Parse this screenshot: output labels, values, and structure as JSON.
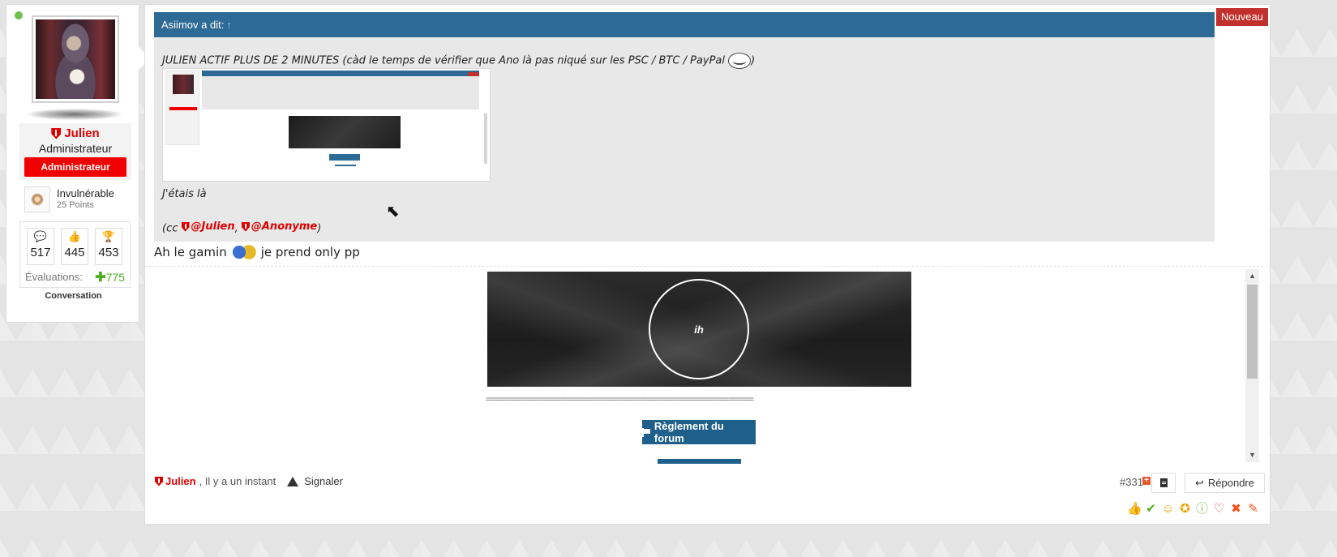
{
  "user": {
    "name": "Julien",
    "title": "Administrateur",
    "badge": "Administrateur",
    "rank_title": "Invulnérable",
    "rank_points": "25 Points",
    "stats": [
      {
        "icon": "comments-icon",
        "glyph": "💬",
        "value": "517"
      },
      {
        "icon": "thumbs-up-icon",
        "glyph": "👍",
        "value": "445"
      },
      {
        "icon": "trophy-icon",
        "glyph": "🏆",
        "value": "453"
      }
    ],
    "evaluations_label": "Évaluations:",
    "evaluations_value": "775",
    "footer_label": "Conversation"
  },
  "post": {
    "new_badge": "Nouveau",
    "quote": {
      "header": "Asiimov a dit:",
      "header_arrow": "↑",
      "line1": "JULIEN ACTIF PLUS DE 2 MINUTES (càd le temps de vérifier que Ano là pas niqué sur les PSC / BTC / PayPal",
      "line1_end": ")",
      "etais": "J'étais là",
      "cc_open": "(cc",
      "mention1": "@Julien",
      "sep": ",",
      "mention2": "@Anonyme",
      "cc_close": ")"
    },
    "reply_part1": "Ah le gamin",
    "reply_part2": "je prend only pp",
    "signature": {
      "logo_text": "ih",
      "separator": "=====================================================",
      "rules_button": "Règlement du forum"
    },
    "footer": {
      "author": "Julien",
      "time": ", Il y a un instant",
      "report": "Signaler",
      "post_number": "#331",
      "plus": "+",
      "reply_button": "Répondre"
    },
    "reactions": [
      {
        "name": "like-reaction-icon",
        "glyph": "👍",
        "color": "#5b8fd6"
      },
      {
        "name": "agree-reaction-icon",
        "glyph": "✔",
        "color": "#4caf1e"
      },
      {
        "name": "funny-reaction-icon",
        "glyph": "☺",
        "color": "#e8a400"
      },
      {
        "name": "winner-reaction-icon",
        "glyph": "✪",
        "color": "#e8a400"
      },
      {
        "name": "info-reaction-icon",
        "glyph": "ⓘ",
        "color": "#7cb342"
      },
      {
        "name": "love-reaction-icon",
        "glyph": "♡",
        "color": "#e53935"
      },
      {
        "name": "disagree-reaction-icon",
        "glyph": "✖",
        "color": "#f4511e"
      },
      {
        "name": "edit-reaction-icon",
        "glyph": "✎",
        "color": "#f4511e"
      }
    ]
  }
}
